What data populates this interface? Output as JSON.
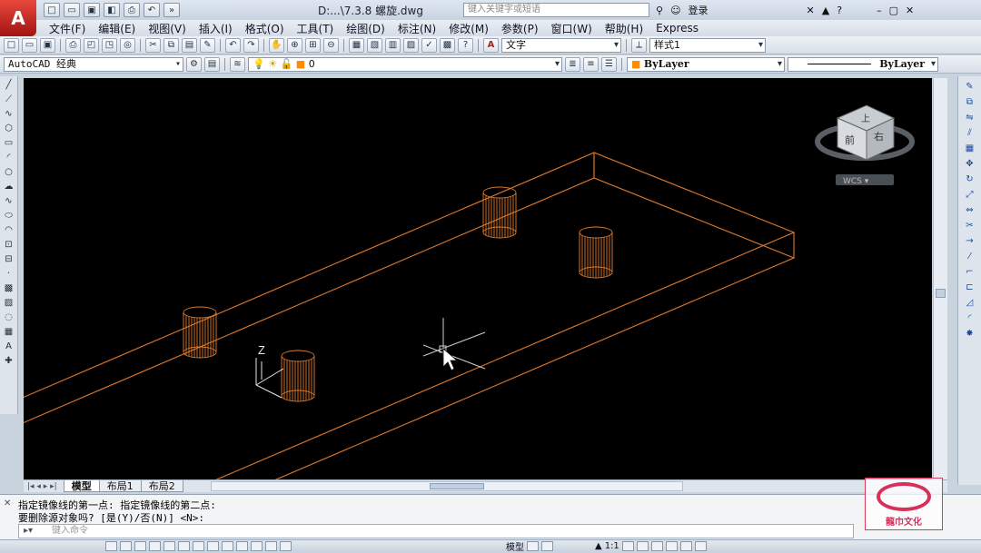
{
  "app": {
    "logo_letter": "A",
    "document_title": "D:...\\7.3.8 螺旋.dwg",
    "search_placeholder": "键入关键字或短语",
    "login_label": "登录",
    "help_label": "?"
  },
  "menu": [
    "文件(F)",
    "编辑(E)",
    "视图(V)",
    "插入(I)",
    "格式(O)",
    "工具(T)",
    "绘图(D)",
    "标注(N)",
    "修改(M)",
    "参数(P)",
    "窗口(W)",
    "帮助(H)",
    "Express"
  ],
  "toolbar1": {
    "text_style_label": "A",
    "text_style_value": "文字",
    "dim_style_value": "样式1"
  },
  "toolbar2": {
    "workspace_value": "AutoCAD 经典",
    "layer_value": "0",
    "color_value": "ByLayer",
    "linetype_value": "ByLayer"
  },
  "colors": {
    "wire": "#e07a2c",
    "viewport_bg": "#000000",
    "ucs": "#e6e6e6"
  },
  "viewcube": {
    "top_label": "上",
    "front_label": "前",
    "right_label": "右",
    "wcs_label": "WCS ▾"
  },
  "ucs": {
    "z_label": "Z"
  },
  "layout_tabs": [
    "模型",
    "布局1",
    "布局2"
  ],
  "command": {
    "line1": "指定镜像线的第一点: 指定镜像线的第二点:",
    "line2": "要删除源对象吗? [是(Y)/否(N)] <N>:",
    "input_placeholder": "键入命令"
  },
  "status": {
    "model_label": "模型",
    "scale_label": "1:1"
  },
  "watermark": {
    "text": "龍巾文化"
  },
  "icons": {
    "left_tools": [
      "line-icon",
      "construction-line-icon",
      "polyline-icon",
      "polygon-icon",
      "rectangle-icon",
      "arc-icon",
      "circle-icon",
      "revision-cloud-icon",
      "spline-icon",
      "ellipse-icon",
      "ellipse-arc-icon",
      "insert-block-icon",
      "make-block-icon",
      "point-icon",
      "hatch-icon",
      "gradient-icon",
      "region-icon",
      "table-icon",
      "mtext-icon",
      "add-selected-icon"
    ],
    "right_tools": [
      "erase-icon",
      "copy-icon",
      "mirror-icon",
      "offset-icon",
      "array-icon",
      "move-icon",
      "rotate-icon",
      "scale-icon",
      "stretch-icon",
      "trim-icon",
      "extend-icon",
      "break-at-point-icon",
      "break-icon",
      "join-icon",
      "chamfer-icon",
      "fillet-icon",
      "explode-icon"
    ]
  }
}
